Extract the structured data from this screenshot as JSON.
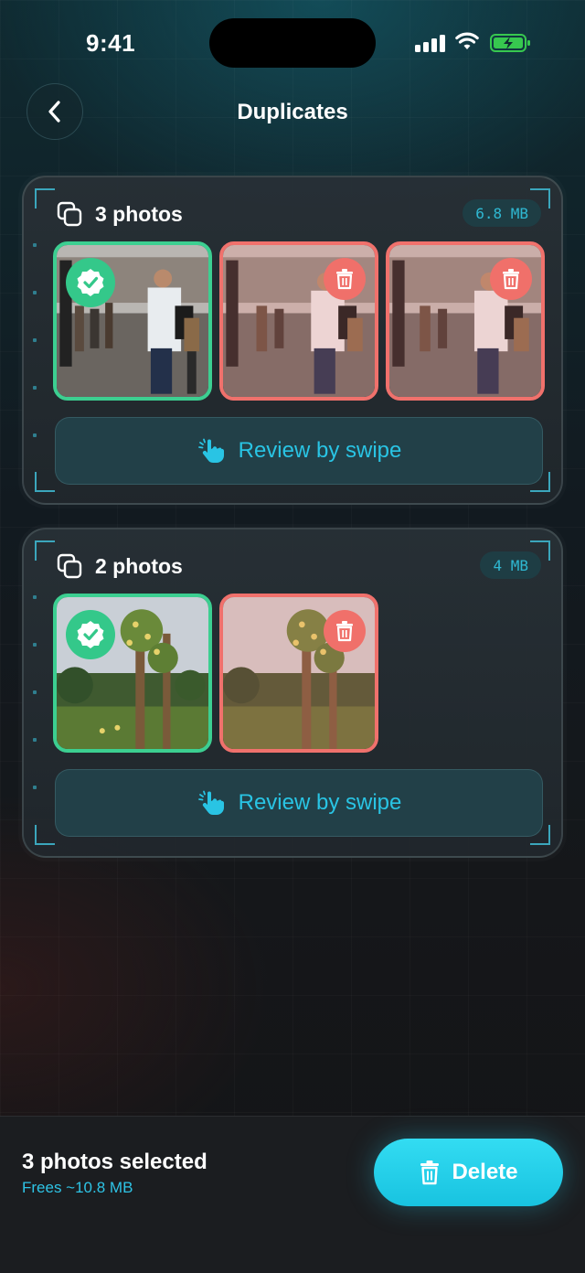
{
  "status_bar": {
    "time": "9:41"
  },
  "header": {
    "title": "Duplicates"
  },
  "groups": [
    {
      "label": "3 photos",
      "size": "6.8 MB",
      "review_label": "Review by swipe"
    },
    {
      "label": "2 photos",
      "size": "4 MB",
      "review_label": "Review by swipe"
    }
  ],
  "icons": {
    "back": "chevron-left-icon",
    "group": "stack-copy-icon",
    "keep": "verified-check-icon",
    "delete": "trash-icon",
    "swipe": "hand-tap-icon"
  },
  "colors": {
    "keep": "#3ccf91",
    "delete": "#f0716c",
    "accent": "#29c4e4"
  },
  "footer": {
    "selected": "3 photos selected",
    "frees": "Frees ~10.8 MB",
    "delete_label": "Delete"
  }
}
